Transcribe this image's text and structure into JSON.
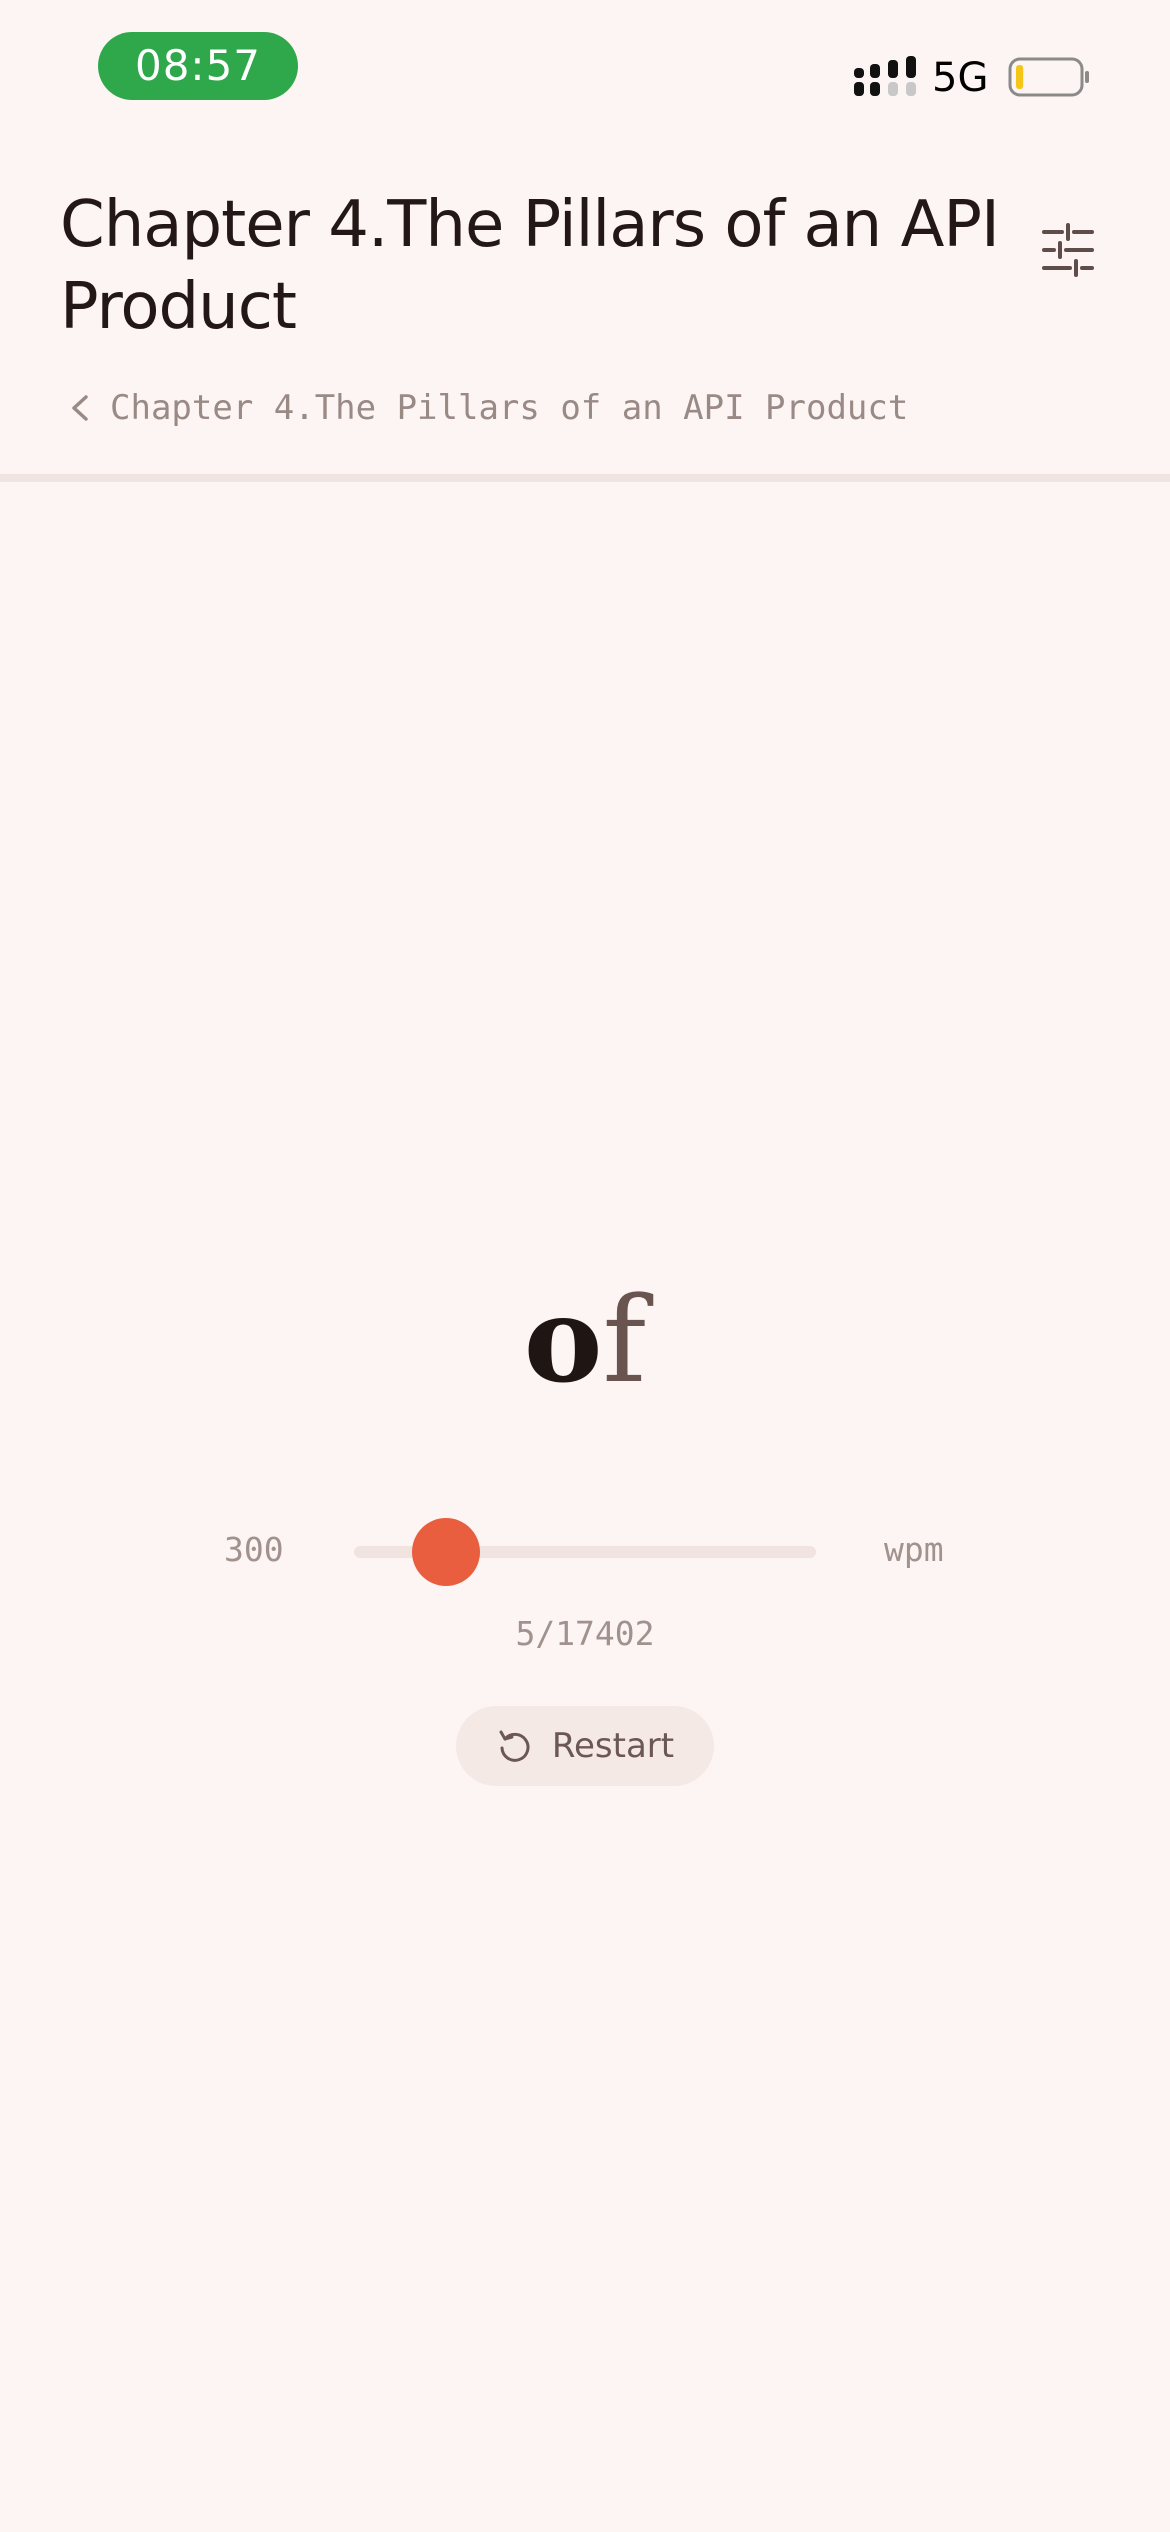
{
  "status_bar": {
    "time": "08:57",
    "network": "5G",
    "battery_level": 0.12,
    "battery_color": "#f5c518",
    "time_pill_color": "#2ea84a"
  },
  "header": {
    "title": "Chapter 4.The Pillars of an API Product",
    "breadcrumb": "Chapter 4.The Pillars of an API Product",
    "settings_icon": "sliders-icon",
    "back_icon": "chevron-left-icon"
  },
  "reader": {
    "word_focus": "o",
    "word_rest": "f",
    "speed": {
      "value": "300",
      "unit": "wpm",
      "slider_fraction": 0.2
    },
    "progress": "5/17402",
    "restart_label": "Restart",
    "restart_icon": "restart-icon",
    "accent_color": "#e85e3e"
  }
}
